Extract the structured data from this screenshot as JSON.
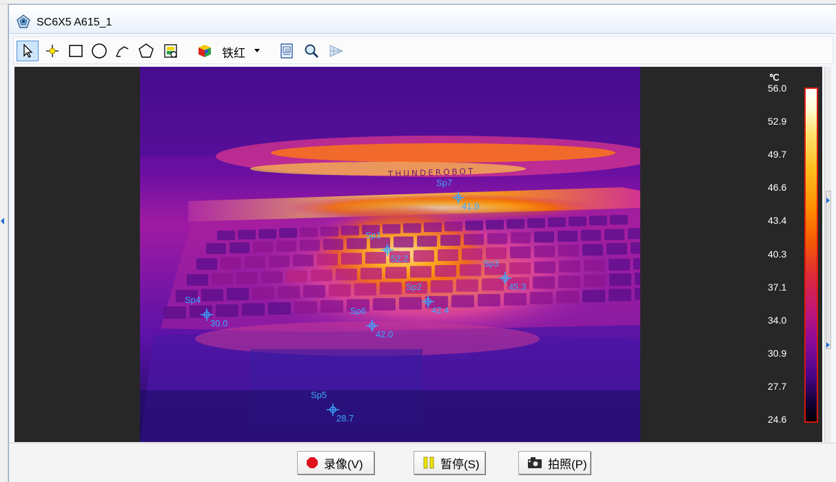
{
  "window": {
    "title": "SC6X5 A615_1"
  },
  "toolbar": {
    "palette_label": "铁红"
  },
  "image": {
    "device_text": "THUNDEROBOT"
  },
  "spots": [
    {
      "label": "Sp7",
      "value": "41.9"
    },
    {
      "label": "Sp1",
      "value": "52.2"
    },
    {
      "label": "Sp3",
      "value": "45.3"
    },
    {
      "label": "Sp2",
      "value": "42.4"
    },
    {
      "label": "Sp4",
      "value": "30.0"
    },
    {
      "label": "Sp6",
      "value": "42.0"
    },
    {
      "label": "Sp5",
      "value": "28.7"
    }
  ],
  "scale": {
    "unit": "℃",
    "ticks": [
      "56.0",
      "52.9",
      "49.7",
      "46.6",
      "43.4",
      "40.3",
      "37.1",
      "34.0",
      "30.9",
      "27.7",
      "24.6"
    ],
    "max": 56.0,
    "min": 24.6,
    "border_color": "#d7190e"
  },
  "buttons": {
    "record": "录像(V)",
    "pause": "暂停(S)",
    "snapshot": "拍照(P)"
  },
  "colors": {
    "record_icon": "#e0101c",
    "pause_icon": "#f2e600",
    "spot_marker": "#3aa8ff"
  },
  "icons": [
    "app-icon",
    "pointer-icon",
    "spot-tool-icon",
    "rectangle-tool-icon",
    "ellipse-tool-icon",
    "polyline-tool-icon",
    "polygon-tool-icon",
    "palette-select-icon",
    "color-cube-icon",
    "report-icon",
    "zoom-icon",
    "isotherm-icon"
  ]
}
